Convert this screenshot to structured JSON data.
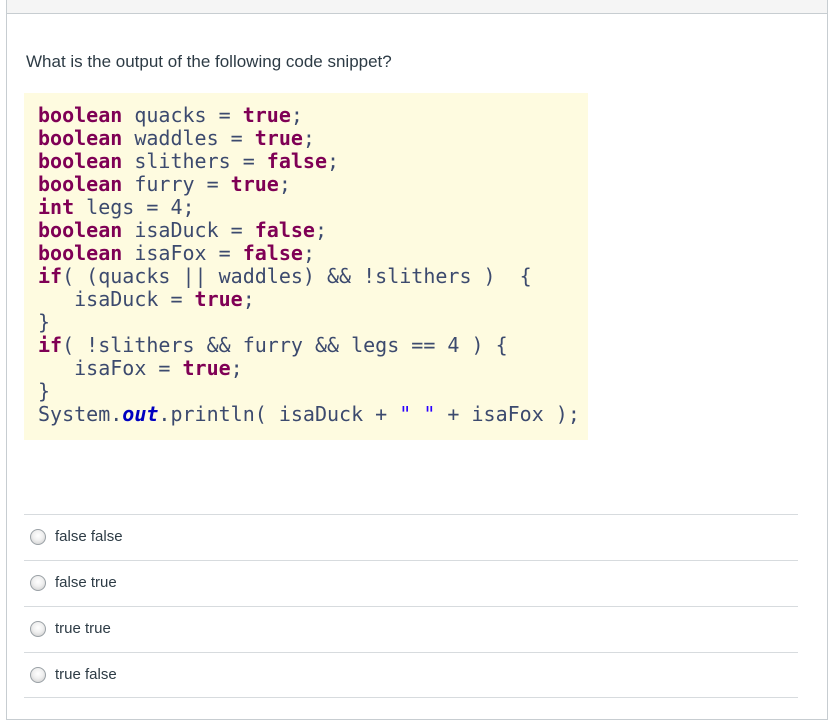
{
  "question": {
    "text": "What is the output of the following code snippet?"
  },
  "code": {
    "tokens": {
      "boolean": "boolean",
      "int": "int",
      "true": "true",
      "false": "false",
      "if": "if",
      "out": "out"
    },
    "l1": " quacks = ",
    "l2": " waddles = ",
    "l3": " slithers = ",
    "l4": " furry = ",
    "l5": " legs = 4;",
    "l6": " isaDuck = ",
    "l7": " isaFox = ",
    "l8": "( (quacks || waddles) && !slithers )  {",
    "l9": "   isaDuck = ",
    "l10": "}",
    "l11": "( !slithers && furry && legs == 4 ) {",
    "l12": "   isaFox = ",
    "l13": "}",
    "l14a": "System.",
    "l14b": ".println( isaDuck + ",
    "l14str": "\" \"",
    "l14c": " + isaFox );",
    "semi": ";"
  },
  "answers": [
    {
      "label": "false false"
    },
    {
      "label": "false true"
    },
    {
      "label": "true true"
    },
    {
      "label": "true false"
    }
  ]
}
